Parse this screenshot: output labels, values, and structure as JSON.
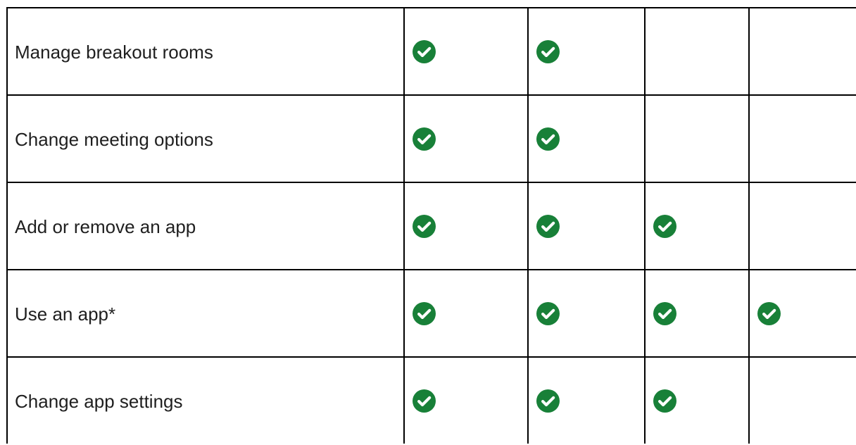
{
  "table": {
    "check_color": "#188038",
    "check_icon": "check-circle-icon",
    "rows": [
      {
        "label": "Manage breakout rooms",
        "checks": [
          true,
          true,
          false,
          false
        ]
      },
      {
        "label": "Change meeting options",
        "checks": [
          true,
          true,
          false,
          false
        ]
      },
      {
        "label": "Add or remove an app",
        "checks": [
          true,
          true,
          true,
          false
        ]
      },
      {
        "label": "Use an app*",
        "checks": [
          true,
          true,
          true,
          true
        ]
      },
      {
        "label": "Change app settings",
        "checks": [
          true,
          true,
          true,
          false
        ]
      }
    ]
  }
}
